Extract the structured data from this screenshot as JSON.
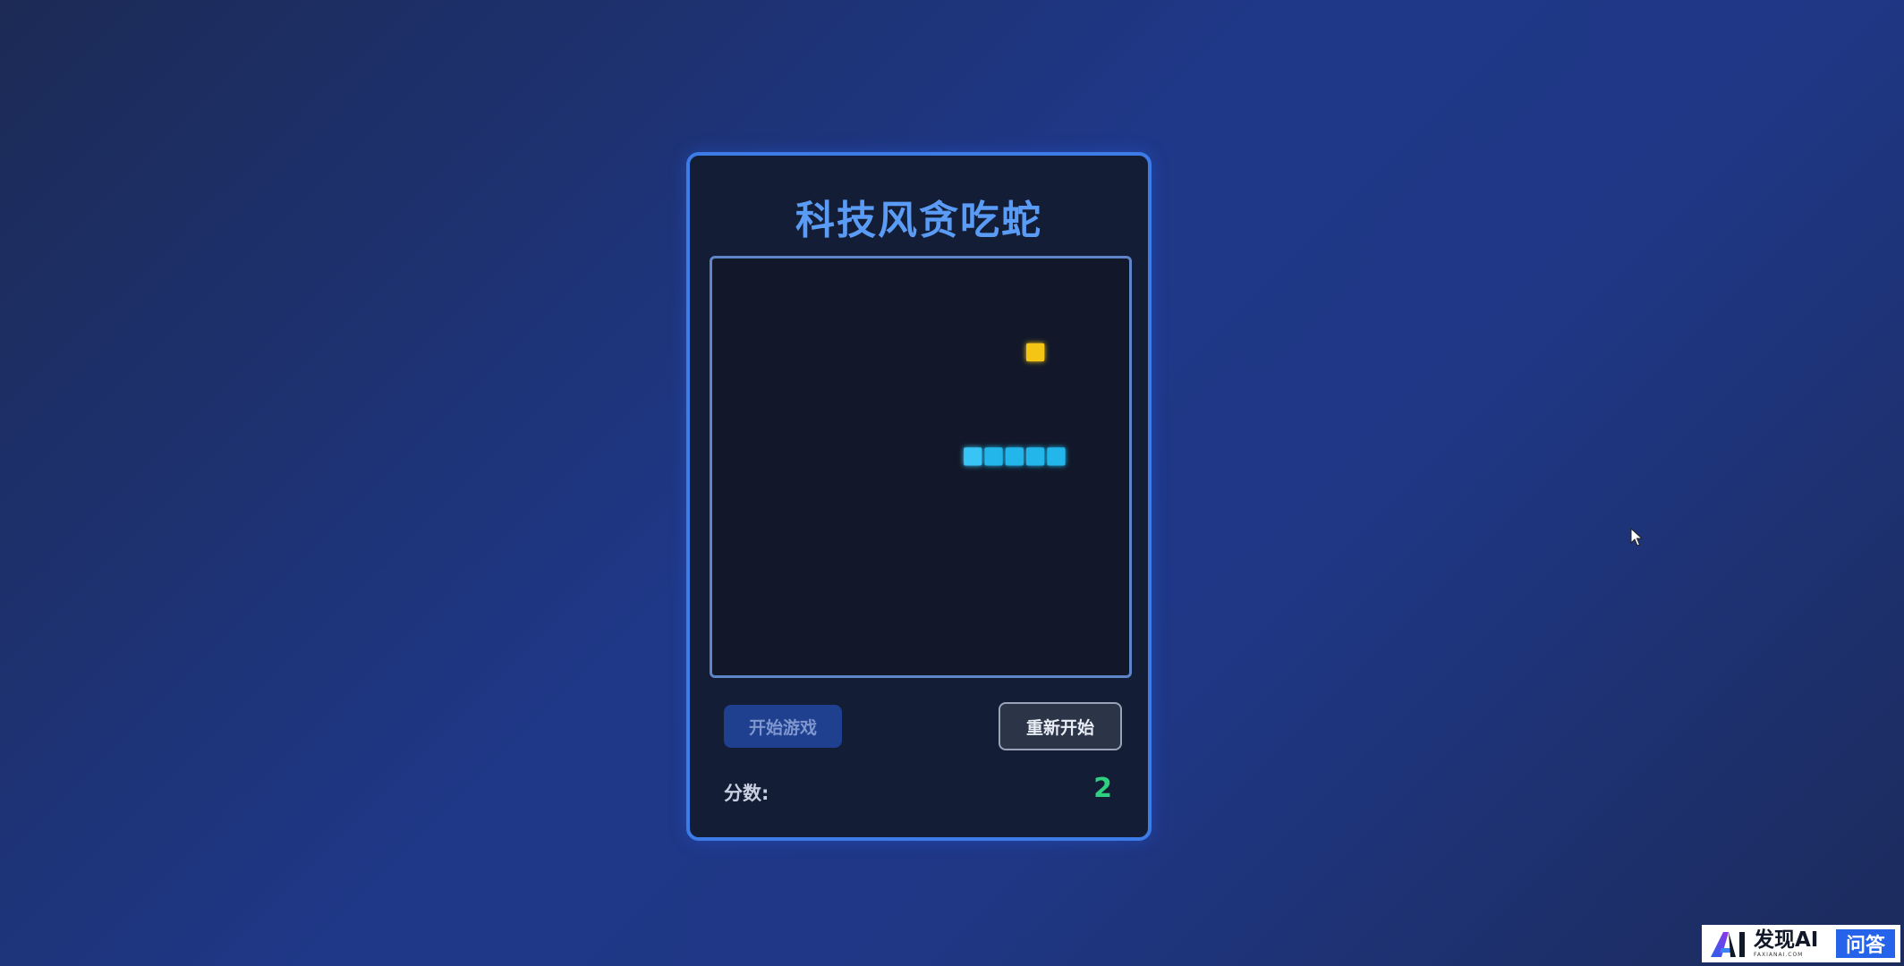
{
  "game": {
    "title": "科技风贪吃蛇",
    "start_label": "开始游戏",
    "restart_label": "重新开始",
    "score_label": "分数:",
    "score_value": "2"
  },
  "board": {
    "grid_size": 20,
    "food": {
      "col": 15,
      "row": 4
    },
    "snake": [
      {
        "col": 12,
        "row": 9
      },
      {
        "col": 13,
        "row": 9
      },
      {
        "col": 14,
        "row": 9
      },
      {
        "col": 15,
        "row": 9
      },
      {
        "col": 16,
        "row": 9
      }
    ],
    "snake_color": "#22b6ea",
    "snake_head_color": "#38c4f5",
    "food_color": "#f5c518",
    "background_color": "#121829"
  },
  "colors": {
    "accent": "#3d7be6",
    "title": "#5a9cf5",
    "score": "#2ecf7e"
  },
  "watermark": {
    "logo_icon": "ai-logo-icon",
    "main": "发现AI",
    "sub": "FAXIANAI.COM",
    "tag": "问答"
  }
}
